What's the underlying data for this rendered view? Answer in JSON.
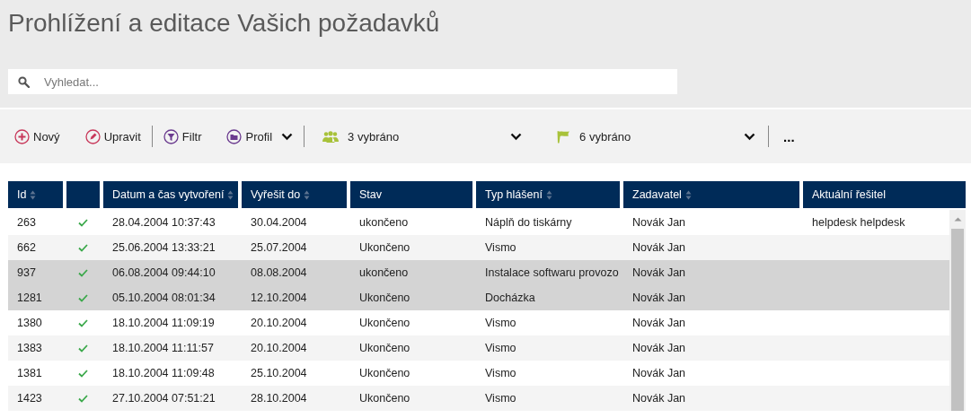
{
  "page_title": "Prohlížení a editace Vašich požadavků",
  "search": {
    "placeholder": "Vyhledat..."
  },
  "toolbar": [
    {
      "kind": "button",
      "label": "Nový"
    },
    {
      "kind": "button",
      "label": "Upravit"
    },
    {
      "kind": "separator"
    },
    {
      "kind": "button",
      "label": "Filtr"
    },
    {
      "kind": "menu",
      "label": "Profil"
    },
    {
      "kind": "separator"
    },
    {
      "kind": "select",
      "label": "3 vybráno"
    },
    {
      "kind": "select",
      "label": "6 vybráno"
    },
    {
      "kind": "separator"
    },
    {
      "kind": "more",
      "label": "..."
    }
  ],
  "table": {
    "columns": [
      {
        "label": "Id",
        "sortable": true
      },
      {
        "sortable": false
      },
      {
        "label": "Datum a čas vytvoření",
        "sortable": true
      },
      {
        "label": "Vyřešit do",
        "sortable": true
      },
      {
        "label": "Stav",
        "sortable": false
      },
      {
        "label": "Typ hlášení",
        "sortable": true
      },
      {
        "label": "Zadavatel",
        "sortable": true
      },
      {
        "label": "Aktuální řešitel",
        "sortable": false
      }
    ],
    "rows": [
      {
        "id": "263",
        "done": true,
        "created": "28.04.2004 10:37:43",
        "due": "30.04.2004",
        "status": "ukončeno",
        "type": "Náplň do tiskárny",
        "requester": "Novák Jan",
        "assignee": "helpdesk helpdesk",
        "selected": false
      },
      {
        "id": "662",
        "done": true,
        "created": "25.06.2004 13:33:21",
        "due": "25.07.2004",
        "status": "Ukončeno",
        "type": "Vismo",
        "requester": "Novák Jan",
        "selected": false
      },
      {
        "id": "937",
        "done": true,
        "created": "06.08.2004 09:44:10",
        "due": "08.08.2004",
        "status": "ukončeno",
        "type": "Instalace softwaru provozo",
        "requester": "Novák Jan",
        "selected": true
      },
      {
        "id": "1281",
        "done": true,
        "created": "05.10.2004 08:01:34",
        "due": "12.10.2004",
        "status": "Ukončeno",
        "type": "Docházka",
        "requester": "Novák Jan",
        "selected": true
      },
      {
        "id": "1380",
        "done": true,
        "created": "18.10.2004 11:09:19",
        "due": "20.10.2004",
        "status": "Ukončeno",
        "type": "Vismo",
        "requester": "Novák Jan",
        "selected": false
      },
      {
        "id": "1383",
        "done": true,
        "created": "18.10.2004 11:11:57",
        "due": "20.10.2004",
        "status": "Ukončeno",
        "type": "Vismo",
        "requester": "Novák Jan",
        "selected": false
      },
      {
        "id": "1381",
        "done": true,
        "created": "18.10.2004 11:09:48",
        "due": "25.10.2004",
        "status": "Ukončeno",
        "type": "Vismo",
        "requester": "Novák Jan",
        "selected": false
      },
      {
        "id": "1423",
        "done": true,
        "created": "27.10.2004 07:51:21",
        "due": "28.10.2004",
        "status": "Ukončeno",
        "type": "Vismo",
        "requester": "Novák Jan",
        "selected": false
      }
    ]
  }
}
